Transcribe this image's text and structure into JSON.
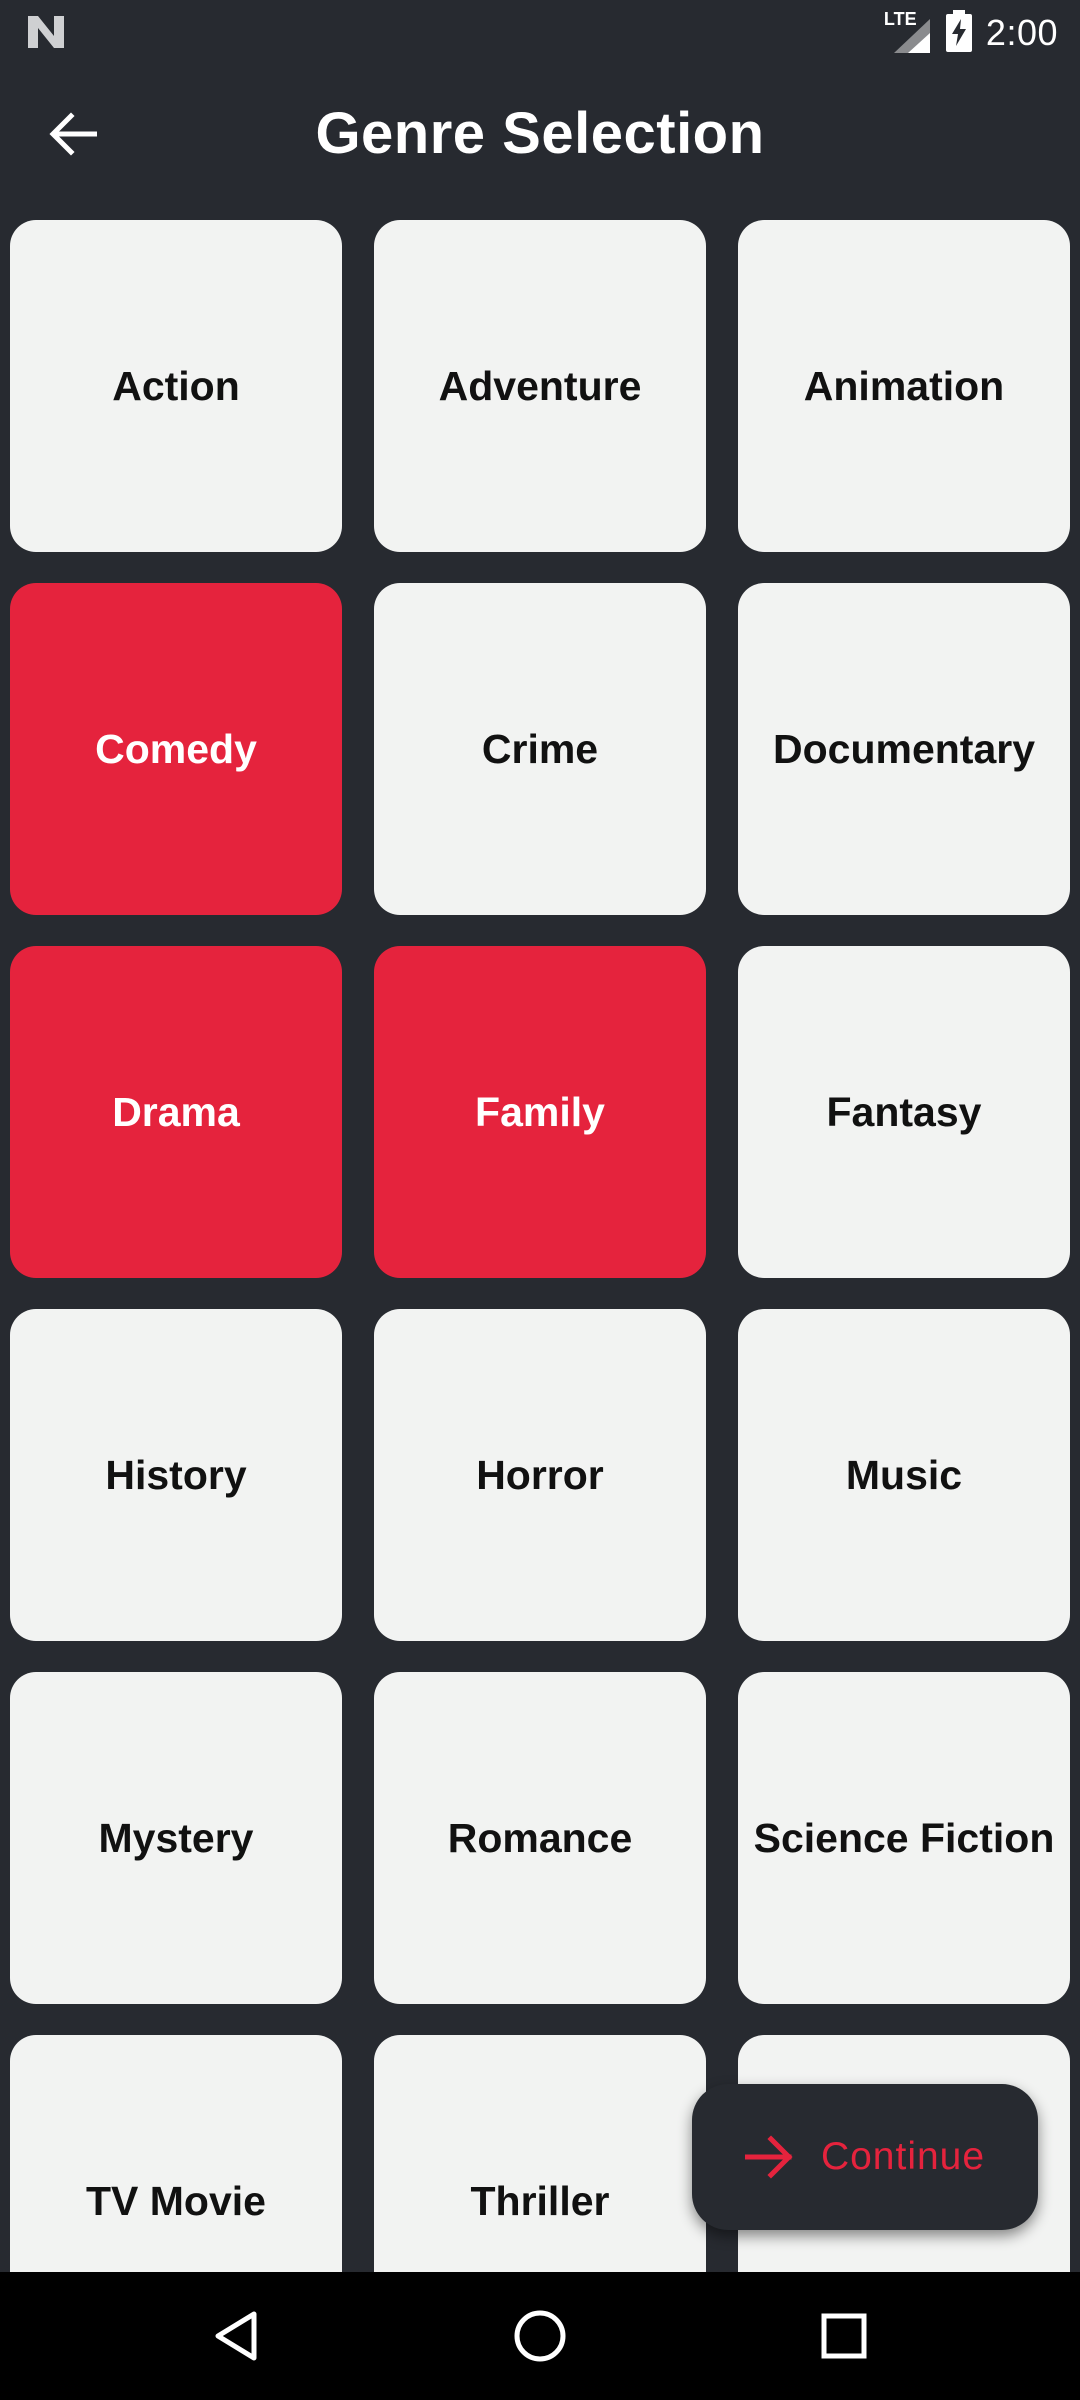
{
  "status_bar": {
    "time": "2:00",
    "network": "LTE"
  },
  "app_bar": {
    "title": "Genre Selection",
    "back_icon": "arrow-left-icon"
  },
  "genres": [
    {
      "label": "Action",
      "selected": false
    },
    {
      "label": "Adventure",
      "selected": false
    },
    {
      "label": "Animation",
      "selected": false
    },
    {
      "label": "Comedy",
      "selected": true
    },
    {
      "label": "Crime",
      "selected": false
    },
    {
      "label": "Documentary",
      "selected": false
    },
    {
      "label": "Drama",
      "selected": true
    },
    {
      "label": "Family",
      "selected": true
    },
    {
      "label": "Fantasy",
      "selected": false
    },
    {
      "label": "History",
      "selected": false
    },
    {
      "label": "Horror",
      "selected": false
    },
    {
      "label": "Music",
      "selected": false
    },
    {
      "label": "Mystery",
      "selected": false
    },
    {
      "label": "Romance",
      "selected": false
    },
    {
      "label": "Science Fiction",
      "selected": false
    },
    {
      "label": "TV Movie",
      "selected": false
    },
    {
      "label": "Thriller",
      "selected": false
    },
    {
      "label": "",
      "selected": false
    }
  ],
  "continue_button": {
    "label": "Continue",
    "icon": "arrow-right-icon"
  },
  "colors": {
    "background": "#272a30",
    "tile": "#f2f3f2",
    "accent": "#e5233d"
  }
}
